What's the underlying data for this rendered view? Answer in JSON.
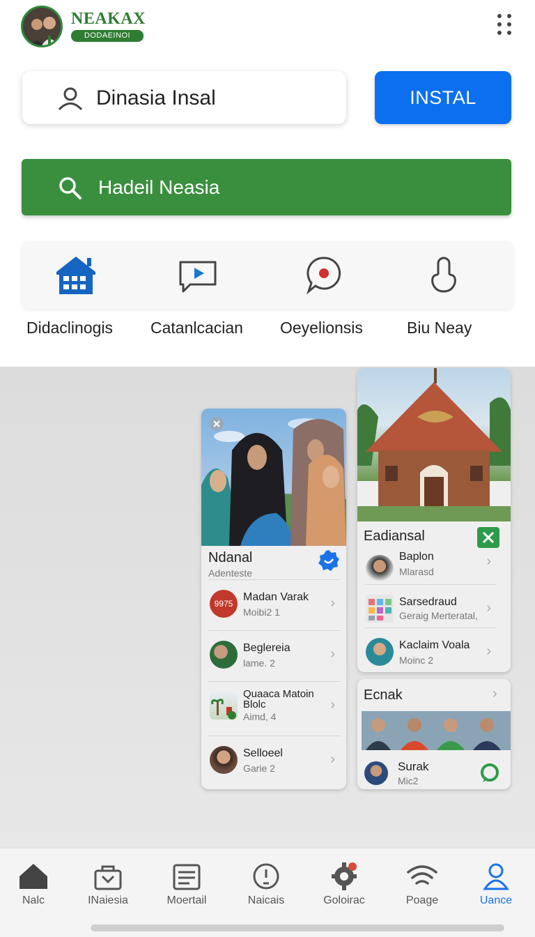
{
  "header": {
    "brand_name": "NEAKAX",
    "brand_sub": "DODAEINOI"
  },
  "account": {
    "value": "Dinasia Insal"
  },
  "install_button": {
    "label": "INSTAL"
  },
  "search": {
    "placeholder": "Hadeil Neasia"
  },
  "categories": [
    {
      "label": "Didaclinogis",
      "icon": "home-grid-icon"
    },
    {
      "label": "Catanlcacian",
      "icon": "video-chat-icon"
    },
    {
      "label": "Oeyelionsis",
      "icon": "chat-record-icon"
    },
    {
      "label": "Biu Neay",
      "icon": "hand-icon"
    }
  ],
  "card_left": {
    "title": "Ndanal",
    "subtitle": "Adenteste",
    "items": [
      {
        "title": "Madan Varak",
        "sub": "Moibi2 1",
        "badge": "9975"
      },
      {
        "title": "Beglereia",
        "sub": "lame. 2"
      },
      {
        "title": "Quaaca Matoin\nBlolc",
        "sub": "Aimd, 4"
      },
      {
        "title": "Selloeel",
        "sub": "Garie 2"
      }
    ]
  },
  "card_right": {
    "title": "Eadiansal",
    "items": [
      {
        "title": "Baplon",
        "sub": "Mlarasd"
      },
      {
        "title": "Sarsedraud",
        "sub": "Geraig Merteratal,"
      },
      {
        "title": "Kaclaim Voala",
        "sub": "Moinc 2"
      }
    ]
  },
  "card_right2": {
    "title": "Ecnak",
    "item": {
      "title": "Surak",
      "sub": "Mic2"
    }
  },
  "bottom_nav": [
    {
      "label": "Nalc",
      "icon": "home-icon"
    },
    {
      "label": "INaiesia",
      "icon": "bag-icon"
    },
    {
      "label": "Moertail",
      "icon": "list-icon"
    },
    {
      "label": "Naicais",
      "icon": "clock-icon"
    },
    {
      "label": "Goloirac",
      "icon": "gear-icon"
    },
    {
      "label": "Poage",
      "icon": "wifi-icon"
    },
    {
      "label": "Uance",
      "icon": "person-icon",
      "active": true
    }
  ],
  "colors": {
    "brand_green": "#2e7d32",
    "search_green": "#3a8f3e",
    "install_blue": "#0b6ff0",
    "active_blue": "#1a73e8"
  }
}
